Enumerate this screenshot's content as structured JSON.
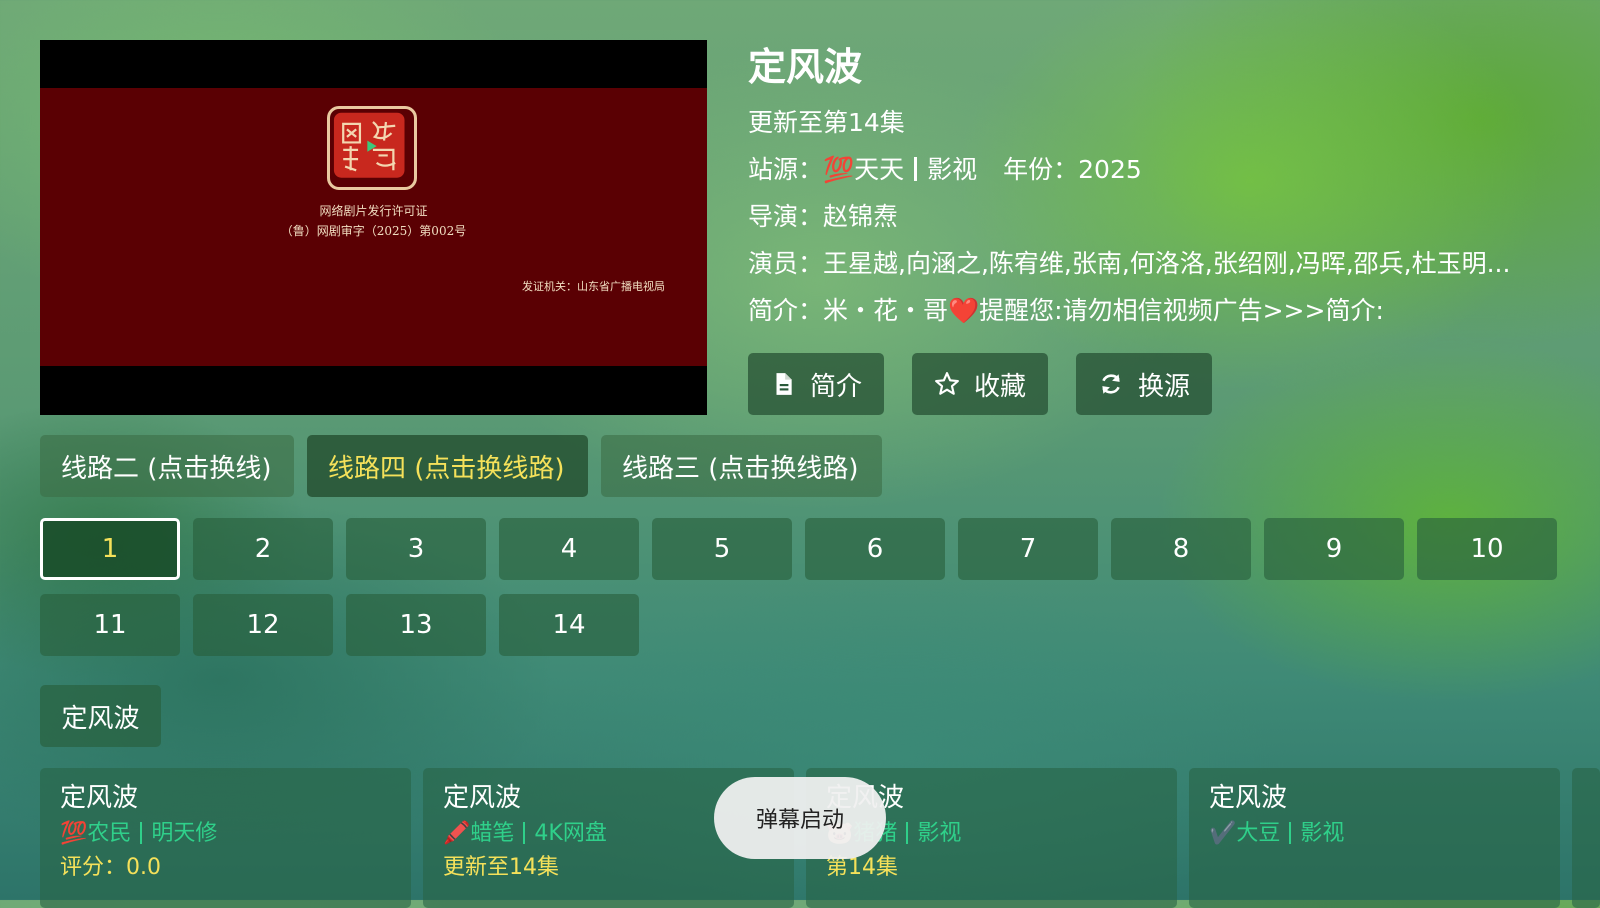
{
  "poster": {
    "license_title": "网络剧片发行许可证",
    "license_number": "（鲁）网剧审字（2025）第002号",
    "issuer": "发证机关：山东省广播电视局"
  },
  "detail": {
    "title": "定风波",
    "update_status": "更新至第14集",
    "source_label": "站源：",
    "source_emoji": "💯",
    "source_name": "天天",
    "source_type": "影视",
    "year_label": "年份：",
    "year": "2025",
    "director_label": "导演：",
    "director": "赵锦焘",
    "cast_label": "演员：",
    "cast": "王星越,向涵之,陈宥维,张南,何洛洛,张绍刚,冯晖,邵兵,杜玉明...",
    "intro_label": "简介：",
    "intro_prefix": "米・花・哥",
    "intro_heart": "❤️",
    "intro_text": "提醒您:请勿相信视频广告>>>简介:"
  },
  "actions": {
    "intro": "简介",
    "favorite": "收藏",
    "switch_source": "换源"
  },
  "lines": [
    {
      "label": "线路二 (点击换线)",
      "active": false
    },
    {
      "label": "线路四 (点击换线路)",
      "active": true
    },
    {
      "label": "线路三 (点击换线路)",
      "active": false
    }
  ],
  "episodes": [
    "1",
    "2",
    "3",
    "4",
    "5",
    "6",
    "7",
    "8",
    "9",
    "10",
    "11",
    "12",
    "13",
    "14"
  ],
  "selected_episode": "1",
  "related_section": "定风波",
  "cards": [
    {
      "title": "定风波",
      "emoji": "💯",
      "source": "农民",
      "type": "明天修",
      "meta": "评分：0.0"
    },
    {
      "title": "定风波",
      "emoji": "🖍️",
      "source": "蜡笔",
      "type": "4K网盘",
      "meta": "更新至14集"
    },
    {
      "title": "定风波",
      "emoji": "🐷",
      "source": "猪猪",
      "type": "影视",
      "meta": "第14集"
    },
    {
      "title": "定风波",
      "emoji": "✔️",
      "source": "大豆",
      "type": "影视",
      "meta": ""
    }
  ],
  "toast": "弹幕启动",
  "colors": {
    "accent_yellow": "#f5e15a",
    "source_green": "#2fd08a",
    "heart_red": "#e0262c"
  }
}
